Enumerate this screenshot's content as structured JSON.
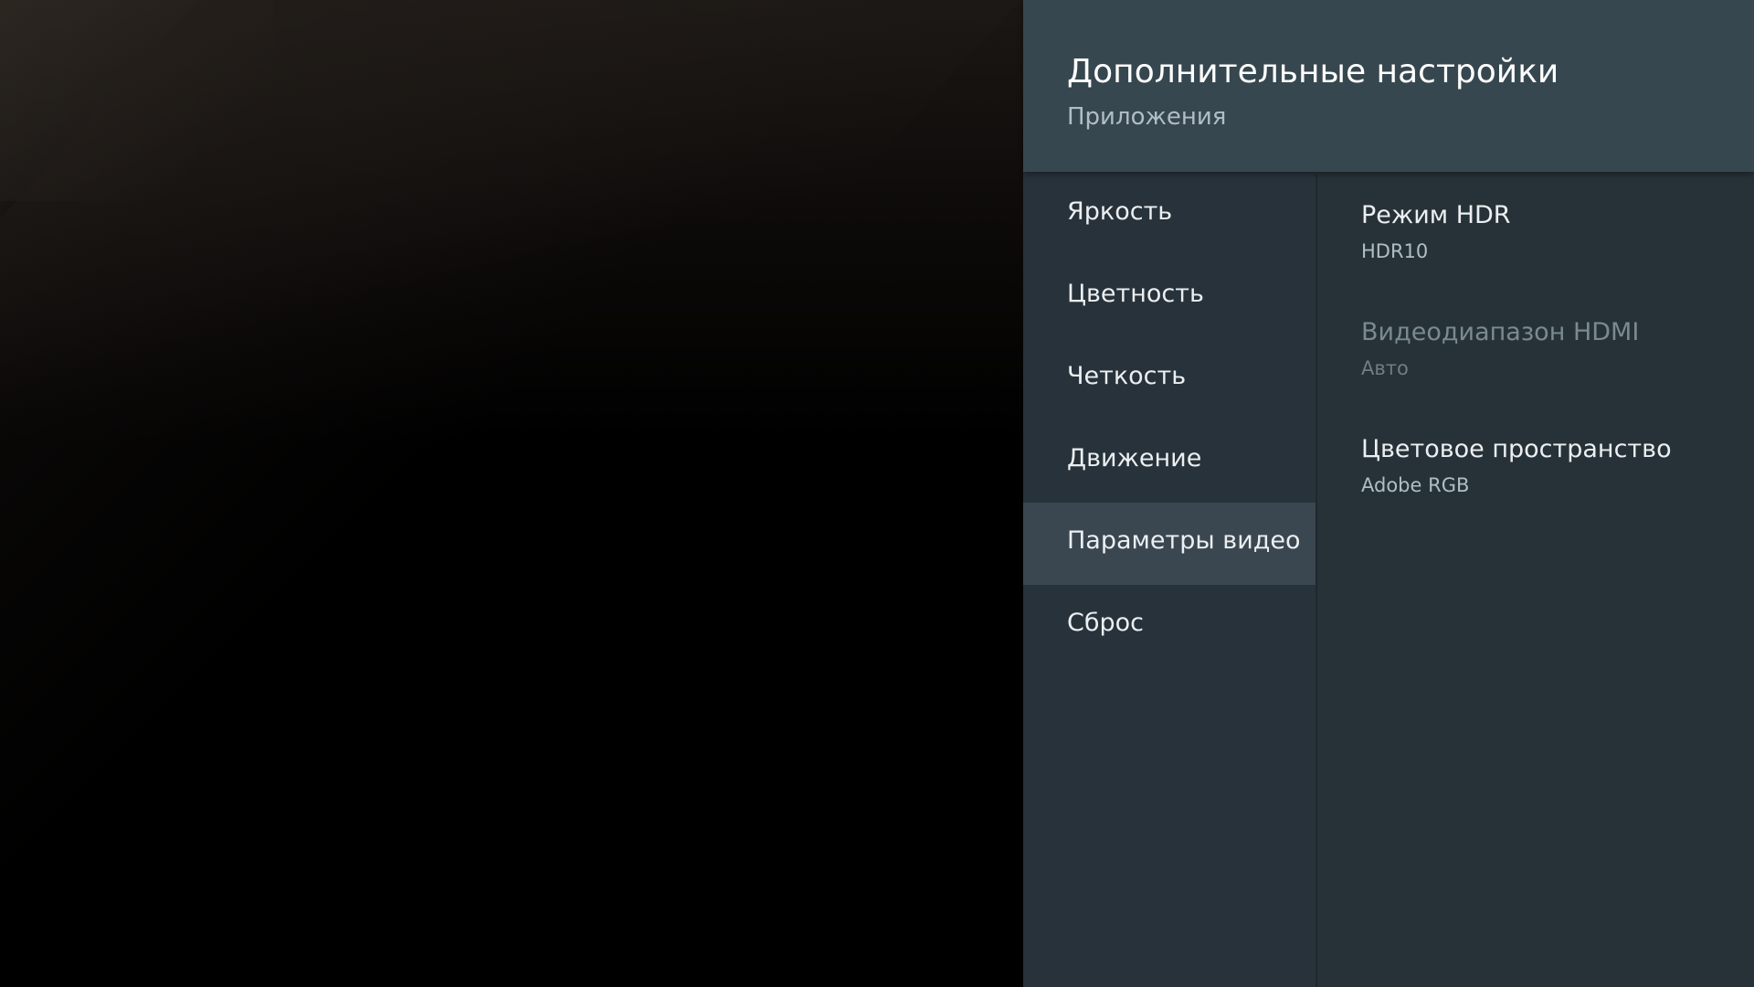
{
  "header": {
    "title": "Дополнительные настройки",
    "subtitle": "Приложения"
  },
  "left_menu": {
    "items": [
      {
        "label": "Яркость"
      },
      {
        "label": "Цветность"
      },
      {
        "label": "Четкость"
      },
      {
        "label": "Движение"
      },
      {
        "label": "Параметры видео"
      },
      {
        "label": "Сброс"
      }
    ],
    "selected": "Параметры видео"
  },
  "right_menu": {
    "options": [
      {
        "title": "Режим HDR",
        "value": "HDR10",
        "enabled": true
      },
      {
        "title": "Видеодиапазон HDMI",
        "value": "Авто",
        "enabled": false
      },
      {
        "title": "Цветовое пространство",
        "value": "Adobe RGB",
        "enabled": true
      }
    ]
  },
  "colors": {
    "header_bg": "#37474f",
    "panel_bg": "#27323a",
    "selected_bg": "#3a4750",
    "text_primary": "#eceff1",
    "text_secondary": "#b0bec5",
    "text_disabled": "#7b8a92"
  }
}
